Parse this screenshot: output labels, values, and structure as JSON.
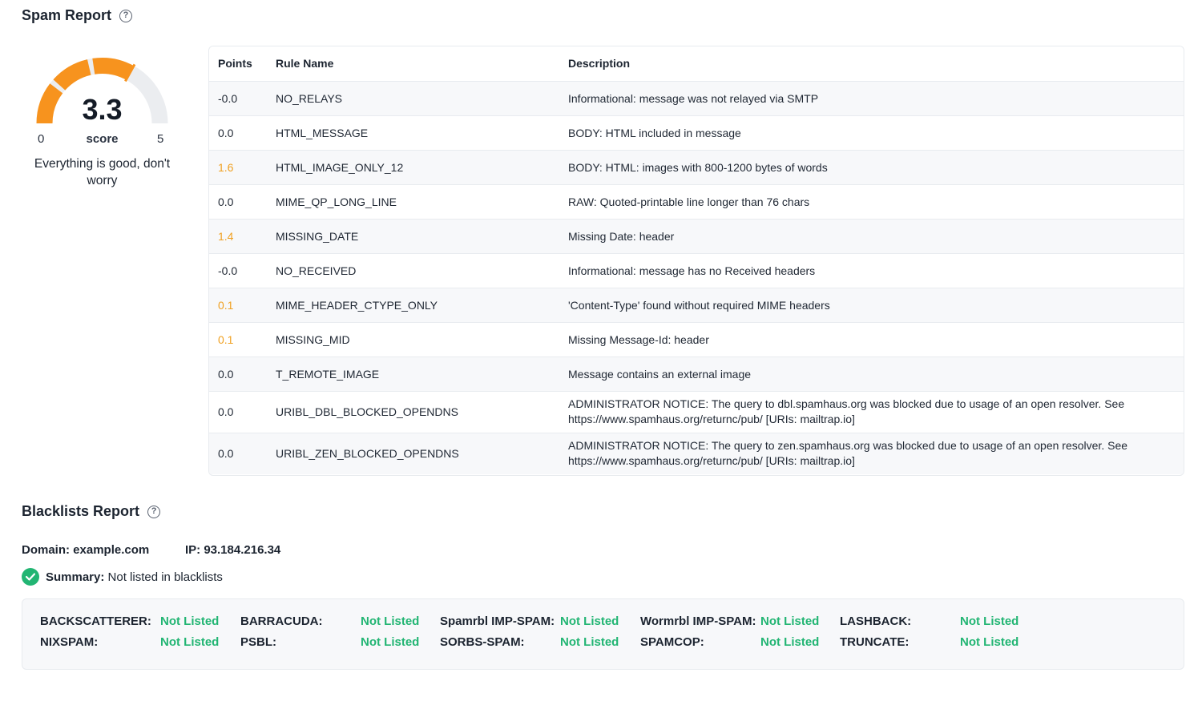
{
  "spam_report": {
    "title": "Spam Report",
    "help_icon": "question-circle-icon",
    "gauge": {
      "value": "3.3",
      "min": "0",
      "max": "5",
      "label": "score",
      "score_fraction": 0.66,
      "note": "Everything is good, don't worry",
      "fill_color": "#f7931e",
      "track_color": "#ebedf0"
    },
    "table": {
      "headers": {
        "points": "Points",
        "rule_name": "Rule Name",
        "description": "Description"
      },
      "rows": [
        {
          "points": "-0.0",
          "rule": "NO_RELAYS",
          "description": "Informational: message was not relayed via SMTP",
          "warn": false
        },
        {
          "points": "0.0",
          "rule": "HTML_MESSAGE",
          "description": "BODY: HTML included in message",
          "warn": false
        },
        {
          "points": "1.6",
          "rule": "HTML_IMAGE_ONLY_12",
          "description": "BODY: HTML: images with 800-1200 bytes of words",
          "warn": true
        },
        {
          "points": "0.0",
          "rule": "MIME_QP_LONG_LINE",
          "description": "RAW: Quoted-printable line longer than 76 chars",
          "warn": false
        },
        {
          "points": "1.4",
          "rule": "MISSING_DATE",
          "description": "Missing Date: header",
          "warn": true
        },
        {
          "points": "-0.0",
          "rule": "NO_RECEIVED",
          "description": "Informational: message has no Received headers",
          "warn": false
        },
        {
          "points": "0.1",
          "rule": "MIME_HEADER_CTYPE_ONLY",
          "description": "'Content-Type' found without required MIME headers",
          "warn": true
        },
        {
          "points": "0.1",
          "rule": "MISSING_MID",
          "description": "Missing Message-Id: header",
          "warn": true
        },
        {
          "points": "0.0",
          "rule": "T_REMOTE_IMAGE",
          "description": "Message contains an external image",
          "warn": false
        },
        {
          "points": "0.0",
          "rule": "URIBL_DBL_BLOCKED_OPENDNS",
          "description": "ADMINISTRATOR NOTICE: The query to dbl.spamhaus.org was blocked due to usage of an open resolver. See https://www.spamhaus.org/returnc/pub/ [URIs: mailtrap.io]",
          "warn": false
        },
        {
          "points": "0.0",
          "rule": "URIBL_ZEN_BLOCKED_OPENDNS",
          "description": "ADMINISTRATOR NOTICE: The query to zen.spamhaus.org was blocked due to usage of an open resolver. See https://www.spamhaus.org/returnc/pub/ [URIs: mailtrap.io]",
          "warn": false
        }
      ]
    }
  },
  "blacklists_report": {
    "title": "Blacklists Report",
    "help_icon": "question-circle-icon",
    "domain": "Domain: example.com",
    "ip": "IP: 93.184.216.34",
    "summary_label": "Summary:",
    "summary_value": " Not listed in blacklists",
    "status_color": "#22b573",
    "lists": [
      {
        "name": "BACKSCATTERER:",
        "status": "Not Listed"
      },
      {
        "name": "BARRACUDA:",
        "status": "Not Listed"
      },
      {
        "name": "Spamrbl IMP-SPAM:",
        "status": "Not Listed"
      },
      {
        "name": "Wormrbl IMP-SPAM:",
        "status": "Not Listed"
      },
      {
        "name": "LASHBACK:",
        "status": "Not Listed"
      },
      {
        "name": "NIXSPAM:",
        "status": "Not Listed"
      },
      {
        "name": "PSBL:",
        "status": "Not Listed"
      },
      {
        "name": "SORBS-SPAM:",
        "status": "Not Listed"
      },
      {
        "name": "SPAMCOP:",
        "status": "Not Listed"
      },
      {
        "name": "TRUNCATE:",
        "status": "Not Listed"
      }
    ]
  }
}
